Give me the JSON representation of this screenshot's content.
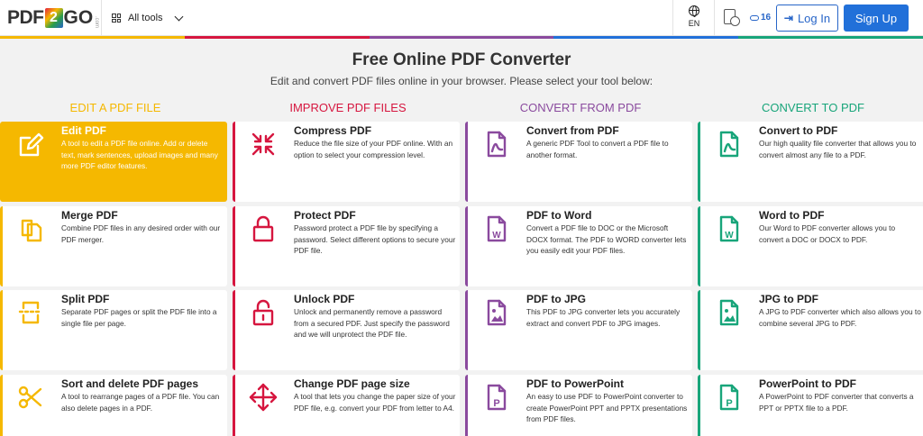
{
  "header": {
    "logo": {
      "left": "PDF",
      "mid": "2",
      "right": "GO",
      "suffix": ".com"
    },
    "all_tools": "All tools",
    "language": "EN",
    "credits": "16",
    "login": "Log In",
    "signup": "Sign Up"
  },
  "colors": {
    "yellow": "#f5b800",
    "red": "#d6163f",
    "purple": "#8a4a9e",
    "green": "#18a57a",
    "blue": "#2170d9"
  },
  "hero": {
    "title": "Free Online PDF Converter",
    "subtitle": "Edit and convert PDF files online in your browser. Please select your tool below:"
  },
  "columns": [
    {
      "heading": "EDIT A PDF FILE",
      "color": "#f5b800",
      "tools": [
        {
          "title": "Edit PDF",
          "icon": "edit-icon",
          "desc": "A tool to edit a PDF file online. Add or delete text, mark sentences, upload images and many more PDF editor features."
        },
        {
          "title": "Merge PDF",
          "icon": "merge-icon",
          "desc": "Combine PDF files in any desired order with our PDF merger."
        },
        {
          "title": "Split PDF",
          "icon": "split-icon",
          "desc": "Separate PDF pages or split the PDF file into a single file per page."
        },
        {
          "title": "Sort and delete PDF pages",
          "icon": "scissors-icon",
          "desc": "A tool to rearrange pages of a PDF file. You can also delete pages in a PDF."
        }
      ]
    },
    {
      "heading": "IMPROVE PDF FILES",
      "color": "#d6163f",
      "tools": [
        {
          "title": "Compress PDF",
          "icon": "compress-icon",
          "desc": "Reduce the file size of your PDF online. With an option to select your compression level."
        },
        {
          "title": "Protect PDF",
          "icon": "lock-icon",
          "desc": "Password protect a PDF file by specifying a password. Select different options to secure your PDF file."
        },
        {
          "title": "Unlock PDF",
          "icon": "unlock-icon",
          "desc": "Unlock and permanently remove a password from a secured PDF. Just specify the password and we will unprotect the PDF file."
        },
        {
          "title": "Change PDF page size",
          "icon": "move-icon",
          "desc": "A tool that lets you change the paper size of your PDF file, e.g. convert your PDF from letter to A4."
        }
      ]
    },
    {
      "heading": "CONVERT FROM PDF",
      "color": "#8a4a9e",
      "tools": [
        {
          "title": "Convert from PDF",
          "icon": "pdf-file-icon",
          "desc": "A generic PDF Tool to convert a PDF file to another format."
        },
        {
          "title": "PDF to Word",
          "icon": "word-file-icon",
          "desc": "Convert a PDF file to DOC or the Microsoft DOCX format. The PDF to WORD converter lets you easily edit your PDF files."
        },
        {
          "title": "PDF to JPG",
          "icon": "image-file-icon",
          "desc": "This PDF to JPG converter lets you accurately extract and convert PDF to JPG images."
        },
        {
          "title": "PDF to PowerPoint",
          "icon": "powerpoint-file-icon",
          "desc": "An easy to use PDF to PowerPoint converter to create PowerPoint PPT and PPTX presentations from PDF files."
        }
      ]
    },
    {
      "heading": "CONVERT TO PDF",
      "color": "#18a57a",
      "tools": [
        {
          "title": "Convert to PDF",
          "icon": "pdf-file-icon",
          "desc": "Our high quality file converter that allows you to convert almost any file to a PDF."
        },
        {
          "title": "Word to PDF",
          "icon": "word-file-icon",
          "desc": "Our Word to PDF converter allows you to convert a DOC or DOCX to PDF."
        },
        {
          "title": "JPG to PDF",
          "icon": "image-file-icon",
          "desc": "A JPG to PDF converter which also allows you to combine several JPG to PDF."
        },
        {
          "title": "PowerPoint to PDF",
          "icon": "powerpoint-file-icon",
          "desc": "A PowerPoint to PDF converter that converts a PPT or PPTX file to a PDF."
        }
      ]
    }
  ]
}
